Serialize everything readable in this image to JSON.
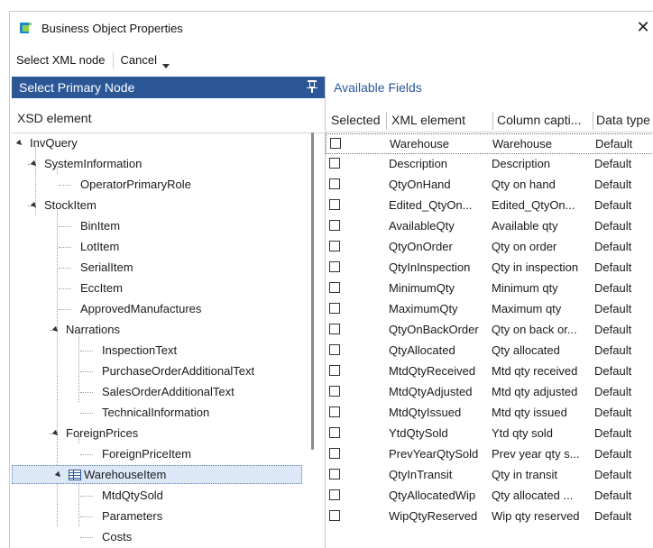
{
  "window": {
    "title": "Business Object Properties",
    "close_glyph": "✕"
  },
  "toolbar": {
    "select_xml_node": "Select XML node",
    "cancel": "Cancel"
  },
  "left_panel": {
    "header": "Select Primary Node",
    "column_label": "XSD element",
    "tree": [
      {
        "label": "InvQuery"
      },
      {
        "label": "SystemInformation"
      },
      {
        "label": "OperatorPrimaryRole"
      },
      {
        "label": "StockItem"
      },
      {
        "label": "BinItem"
      },
      {
        "label": "LotItem"
      },
      {
        "label": "SerialItem"
      },
      {
        "label": "EccItem"
      },
      {
        "label": "ApprovedManufactures"
      },
      {
        "label": "Narrations"
      },
      {
        "label": "InspectionText"
      },
      {
        "label": "PurchaseOrderAdditionalText"
      },
      {
        "label": "SalesOrderAdditionalText"
      },
      {
        "label": "TechnicalInformation"
      },
      {
        "label": "ForeignPrices"
      },
      {
        "label": "ForeignPriceItem"
      },
      {
        "label": "WarehouseItem"
      },
      {
        "label": "MtdQtySold"
      },
      {
        "label": "Parameters"
      },
      {
        "label": "Costs"
      }
    ]
  },
  "right_panel": {
    "title": "Available Fields",
    "columns": [
      "Selected",
      "XML element",
      "Column capti...",
      "Data type"
    ],
    "rows": [
      {
        "xml": "Warehouse",
        "caption": "Warehouse",
        "type": "Default",
        "checked": false
      },
      {
        "xml": "Description",
        "caption": "Description",
        "type": "Default",
        "checked": false
      },
      {
        "xml": "QtyOnHand",
        "caption": "Qty on hand",
        "type": "Default",
        "checked": false
      },
      {
        "xml": "Edited_QtyOn...",
        "caption": "Edited_QtyOn...",
        "type": "Default",
        "checked": false
      },
      {
        "xml": "AvailableQty",
        "caption": "Available qty",
        "type": "Default",
        "checked": false
      },
      {
        "xml": "QtyOnOrder",
        "caption": "Qty on order",
        "type": "Default",
        "checked": false
      },
      {
        "xml": "QtyInInspection",
        "caption": "Qty in inspection",
        "type": "Default",
        "checked": false
      },
      {
        "xml": "MinimumQty",
        "caption": "Minimum qty",
        "type": "Default",
        "checked": false
      },
      {
        "xml": "MaximumQty",
        "caption": "Maximum qty",
        "type": "Default",
        "checked": false
      },
      {
        "xml": "QtyOnBackOrder",
        "caption": "Qty on back or...",
        "type": "Default",
        "checked": false
      },
      {
        "xml": "QtyAllocated",
        "caption": "Qty allocated",
        "type": "Default",
        "checked": false
      },
      {
        "xml": "MtdQtyReceived",
        "caption": "Mtd qty received",
        "type": "Default",
        "checked": false
      },
      {
        "xml": "MtdQtyAdjusted",
        "caption": "Mtd qty adjusted",
        "type": "Default",
        "checked": false
      },
      {
        "xml": "MtdQtyIssued",
        "caption": "Mtd qty issued",
        "type": "Default",
        "checked": false
      },
      {
        "xml": "YtdQtySold",
        "caption": "Ytd qty sold",
        "type": "Default",
        "checked": false
      },
      {
        "xml": "PrevYearQtySold",
        "caption": "Prev year qty s...",
        "type": "Default",
        "checked": false
      },
      {
        "xml": "QtyInTransit",
        "caption": "Qty in transit",
        "type": "Default",
        "checked": false
      },
      {
        "xml": "QtyAllocatedWip",
        "caption": "Qty allocated ...",
        "type": "Default",
        "checked": false
      },
      {
        "xml": "WipQtyReserved",
        "caption": "Wip qty reserved",
        "type": "Default",
        "checked": false
      }
    ]
  },
  "colors": {
    "accent": "#2b5797",
    "selection": "#dce8f7"
  }
}
